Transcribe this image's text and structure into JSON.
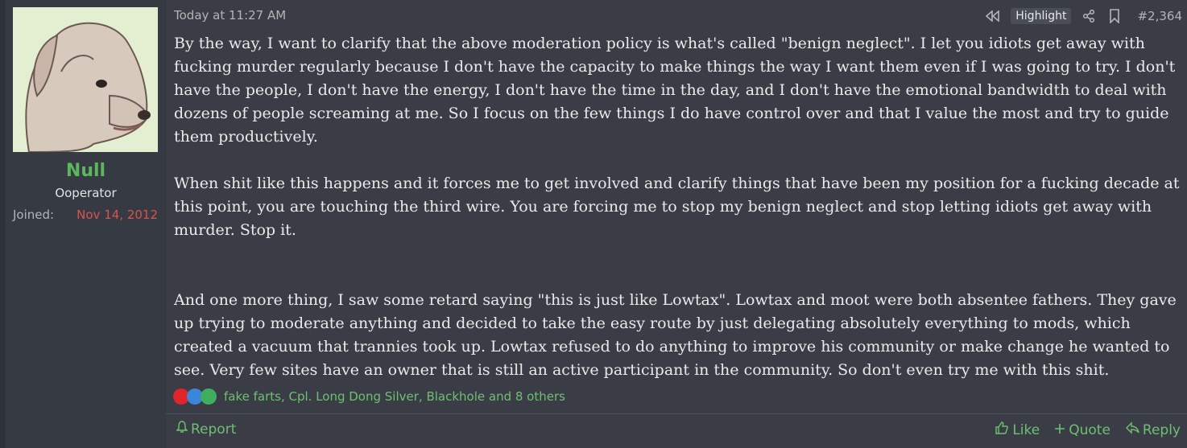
{
  "user": {
    "name": "Null",
    "title": "Ooperator",
    "joined_label": "Joined:",
    "joined_date": "Nov 14, 2012"
  },
  "post": {
    "timestamp": "Today at 11:27 AM",
    "highlight_label": "Highlight",
    "number": "#2,364",
    "paragraphs": [
      "By the way, I want to clarify that the above moderation policy is what's called \"benign neglect\". I let you idiots get away with fucking murder regularly because I don't have the capacity to make things the way I want them even if I was going to try. I don't have the people, I don't have the energy, I don't have the time in the day, and I don't have the emotional bandwidth to deal with dozens of people screaming at me. So I focus on the few things I do have control over and that I value the most and try to guide them productively.",
      "When shit like this happens and it forces me to get involved and clarify things that have been my position for a fucking decade at this point, you are touching the third wire. You are forcing me to stop my benign neglect and stop letting idiots get away with murder. Stop it.",
      "And one more thing, I saw some retard saying \"this is just like Lowtax\". Lowtax and moot were both absentee fathers. They gave up trying to moderate anything and decided to take the easy route by just delegating absolutely everything to mods, which created a vacuum that trannies took up. Lowtax refused to do anything to improve his community or make change he wanted to see. Very few sites have an owner that is still an active participant in the community. So don't even try me with this shit."
    ],
    "reactions_text": "fake farts, Cpl. Long Dong Silver, Blackhole and 8 others"
  },
  "footer": {
    "report": "Report",
    "like": "Like",
    "quote": "Quote",
    "reply": "Reply"
  },
  "icons": [
    "rewind-icon",
    "share-icon",
    "bookmark-icon",
    "heart-icon",
    "thumbs-up-icon",
    "check-icon",
    "bell-icon",
    "plus-icon",
    "reply-arrow-icon"
  ],
  "colors": {
    "username": "#5cb85c",
    "joined_date": "#d9534f",
    "action_links": "#6fbf73"
  }
}
